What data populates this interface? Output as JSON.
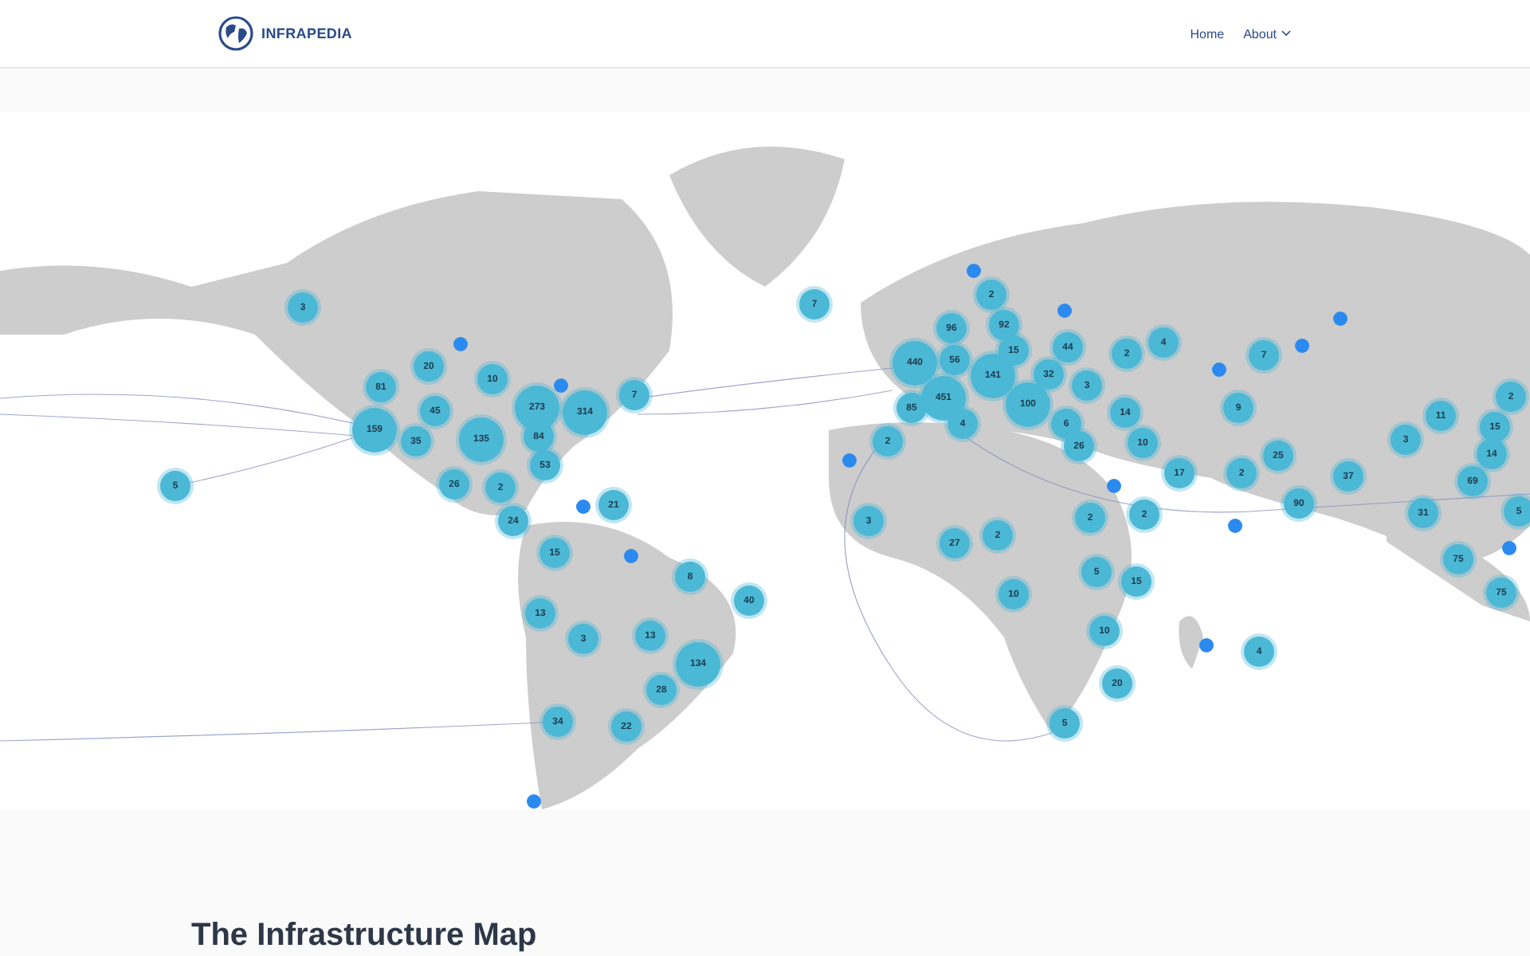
{
  "header": {
    "brand": "INFRAPEDIA",
    "nav": [
      {
        "label": "Home",
        "kind": "link"
      },
      {
        "label": "About",
        "kind": "dropdown"
      }
    ]
  },
  "map": {
    "clusters": [
      {
        "count": "3"
      },
      {
        "count": "81"
      },
      {
        "count": "20"
      },
      {
        "count": "10"
      },
      {
        "count": "45"
      },
      {
        "count": "159"
      },
      {
        "count": "35"
      },
      {
        "count": "135"
      },
      {
        "count": "273"
      },
      {
        "count": "84"
      },
      {
        "count": "314"
      },
      {
        "count": "7"
      },
      {
        "count": "53"
      },
      {
        "count": "26"
      },
      {
        "count": "2"
      },
      {
        "count": "24"
      },
      {
        "count": "21"
      },
      {
        "count": "15"
      },
      {
        "count": "8"
      },
      {
        "count": "40"
      },
      {
        "count": "13"
      },
      {
        "count": "3"
      },
      {
        "count": "13"
      },
      {
        "count": "134"
      },
      {
        "count": "28"
      },
      {
        "count": "34"
      },
      {
        "count": "22"
      },
      {
        "count": "5"
      },
      {
        "count": "7"
      },
      {
        "count": "2"
      },
      {
        "count": "92"
      },
      {
        "count": "96"
      },
      {
        "count": "15"
      },
      {
        "count": "440"
      },
      {
        "count": "56"
      },
      {
        "count": "141"
      },
      {
        "count": "451"
      },
      {
        "count": "32"
      },
      {
        "count": "44"
      },
      {
        "count": "2"
      },
      {
        "count": "4"
      },
      {
        "count": "7"
      },
      {
        "count": "3"
      },
      {
        "count": "100"
      },
      {
        "count": "85"
      },
      {
        "count": "2"
      },
      {
        "count": "4"
      },
      {
        "count": "6"
      },
      {
        "count": "26"
      },
      {
        "count": "14"
      },
      {
        "count": "10"
      },
      {
        "count": "9"
      },
      {
        "count": "17"
      },
      {
        "count": "2"
      },
      {
        "count": "25"
      },
      {
        "count": "37"
      },
      {
        "count": "90"
      },
      {
        "count": "11"
      },
      {
        "count": "3"
      },
      {
        "count": "2"
      },
      {
        "count": "15"
      },
      {
        "count": "14"
      },
      {
        "count": "69"
      },
      {
        "count": "31"
      },
      {
        "count": "5"
      },
      {
        "count": "2"
      },
      {
        "count": "2"
      },
      {
        "count": "3"
      },
      {
        "count": "27"
      },
      {
        "count": "2"
      },
      {
        "count": "5"
      },
      {
        "count": "15"
      },
      {
        "count": "10"
      },
      {
        "count": "10"
      },
      {
        "count": "20"
      },
      {
        "count": "5"
      },
      {
        "count": "4"
      },
      {
        "count": "75"
      },
      {
        "count": "75"
      }
    ]
  },
  "section": {
    "title": "The Infrastructure Map"
  }
}
